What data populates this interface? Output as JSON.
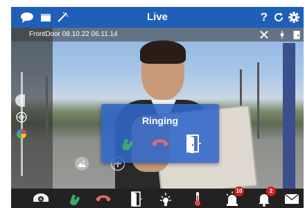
{
  "header": {
    "title": "Live",
    "accent": "#1f5fb8",
    "left_icons": [
      "chat-icon",
      "window-icon",
      "wand-icon"
    ],
    "right_icons": [
      "help-icon",
      "refresh-icon",
      "gear-icon"
    ],
    "help_label": "?"
  },
  "camera": {
    "name": "FrontDoor",
    "date": "08.10.22",
    "time": "06.11.14",
    "overlay_icons": [
      "crossed-tools-icon",
      "light-icon",
      "door-icon"
    ]
  },
  "call_dialog": {
    "title": "Ringing",
    "accept_color": "#3fa86a",
    "hangup_color": "#e46a6a",
    "buttons": [
      "accept-call-icon",
      "hang-up-icon",
      "door-open-icon"
    ]
  },
  "toolbar": {
    "items": [
      "camera-icon",
      "call-icon",
      "hang-up-icon",
      "door-icon",
      "light-icon",
      "thermometer-icon",
      "alarm-icon",
      "bell-icon",
      "mail-icon"
    ],
    "alarm_count": "10",
    "bell_count": "2",
    "badge_color": "#d21f1f"
  }
}
